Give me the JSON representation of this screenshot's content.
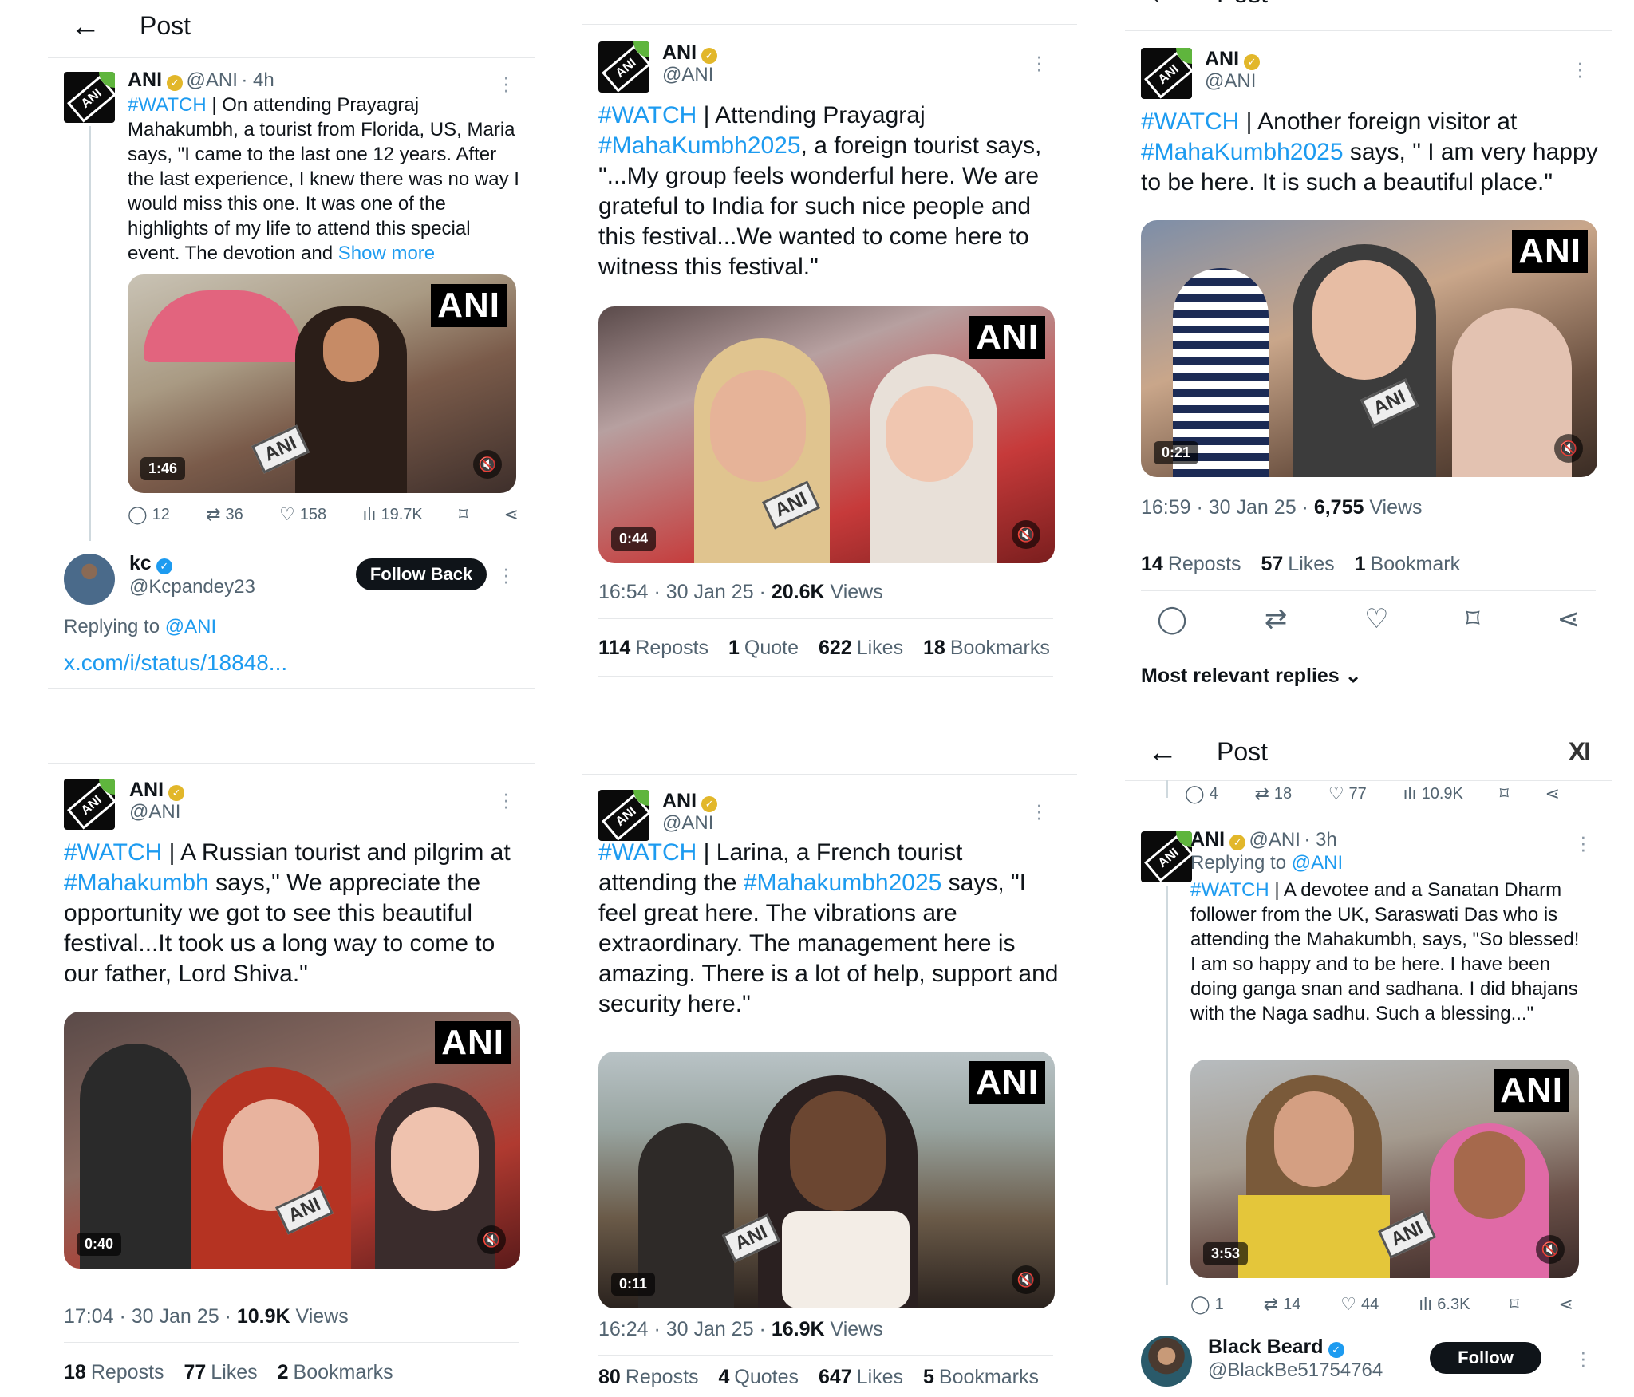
{
  "p1": {
    "header_title": "Post",
    "user": "ANI",
    "handle": "@ANI",
    "time": "· 4h",
    "text_tag": "#WATCH",
    "text_body": " | On attending Prayagraj Mahakumbh, a tourist from Florida, US, Maria says, \"I came to the last one 12 years. After the last experience, I knew there was no way I would miss this one. It was one of the highlights of my life to attend this special event. The devotion and ",
    "show_more": "Show more",
    "logo": "ANI",
    "duration": "1:46",
    "replies": "12",
    "reposts": "36",
    "likes": "158",
    "views": "19.7K",
    "reply_user": "kc",
    "reply_handle": "@Kcpandey23",
    "follow_back": "Follow Back",
    "replying_to_label": "Replying to ",
    "replying_to": "@ANI",
    "link": "x.com/i/status/18848..."
  },
  "p2": {
    "user": "ANI",
    "handle": "@ANI",
    "tag1": "#WATCH",
    "t1": " | Attending Prayagraj ",
    "tag2": "#MahaKumbh2025",
    "t2": ", a foreign tourist says, \"...My group feels wonderful here. We are grateful to India for such nice people and this festival...We wanted to come here to witness this festival.\"",
    "logo": "ANI",
    "duration": "0:44",
    "time": "16:54 · 30 Jan 25 · ",
    "views_num": "20.6K",
    "views_label": " Views",
    "reposts_num": "114",
    "reposts_label": "Reposts",
    "quotes_num": "1",
    "quotes_label": "Quote",
    "likes_num": "622",
    "likes_label": "Likes",
    "bookmarks_num": "18",
    "bookmarks_label": "Bookmarks"
  },
  "p3": {
    "header_title": "Post",
    "user": "ANI",
    "handle": "@ANI",
    "tag1": "#WATCH",
    "t1": " | Another foreign visitor at ",
    "tag2": "#MahaKumbh2025",
    "t2": " says, \" I am very happy to be here. It is such a beautiful place.\"",
    "logo": "ANI",
    "duration": "0:21",
    "time": "16:59 · 30 Jan 25 · ",
    "views_num": "6,755",
    "views_label": " Views",
    "reposts_num": "14",
    "reposts_label": "Reposts",
    "likes_num": "57",
    "likes_label": "Likes",
    "bookmarks_num": "1",
    "bookmarks_label": "Bookmark",
    "sort_label": "Most relevant replies"
  },
  "p4": {
    "header_title": "Post",
    "user": "ANI",
    "handle": "@ANI",
    "tag1": "#WATCH",
    "t1": " | A Russian tourist and pilgrim at ",
    "tag2": "#Mahakumbh",
    "t2": " says,\" We appreciate the opportunity we got to see this beautiful festival...It took us a long way to come to our father, Lord Shiva.\"",
    "logo": "ANI",
    "duration": "0:40",
    "time": "17:04 · 30 Jan 25 · ",
    "views_num": "10.9K",
    "views_label": " Views",
    "reposts_num": "18",
    "reposts_label": "Reposts",
    "likes_num": "77",
    "likes_label": "Likes",
    "bookmarks_num": "2",
    "bookmarks_label": "Bookmarks"
  },
  "p5": {
    "user": "ANI",
    "handle": "@ANI",
    "tag1": "#WATCH",
    "t1": " | Larina, a French tourist attending the ",
    "tag2": "#Mahakumbh2025",
    "t2": " says, \"I feel great here. The vibrations are extraordinary. The management here is amazing. There is a lot of help, support and security here.\"",
    "logo": "ANI",
    "duration": "0:11",
    "time": "16:24 · 30 Jan 25 · ",
    "views_num": "16.9K",
    "views_label": " Views",
    "reposts_num": "80",
    "reposts_label": "Reposts",
    "quotes_num": "4",
    "quotes_label": "Quotes",
    "likes_num": "647",
    "likes_label": "Likes",
    "bookmarks_num": "5",
    "bookmarks_label": "Bookmarks"
  },
  "p6": {
    "header_title": "Post",
    "header_logo": "XI",
    "top_replies": "4",
    "top_reposts": "18",
    "top_likes": "77",
    "top_views": "10.9K",
    "user": "ANI",
    "handle": "@ANI",
    "time": "· 3h",
    "replying_to_label": "Replying to ",
    "replying_to": "@ANI",
    "tag1": "#WATCH",
    "t1": " | A devotee and a Sanatan Dharm follower from the UK, Saraswati Das who is attending the Mahakumbh, says, \"So blessed! I am so happy and to be here. I have been doing ganga snan and sadhana. I did bhajans with the Naga sadhu. Such a blessing...\"",
    "logo": "ANI",
    "duration": "3:53",
    "replies": "1",
    "reposts": "14",
    "likes": "44",
    "views": "6.3K",
    "reply_user": "Black Beard",
    "reply_handle": "@BlackBe51754764",
    "follow": "Follow"
  },
  "icons": {
    "back": "←",
    "reply": "◯",
    "repost": "⇄",
    "like": "♡",
    "views": "ılı",
    "bookmark": "⌑",
    "share": "⋖",
    "mute": "🔇",
    "chevron": "⌄",
    "check": "✓"
  },
  "colors": {
    "link": "#1d9bf0",
    "gold_badge": "#e2b72a",
    "blue_badge": "#1d9bf0",
    "text": "#0f1419",
    "muted": "#536471"
  }
}
